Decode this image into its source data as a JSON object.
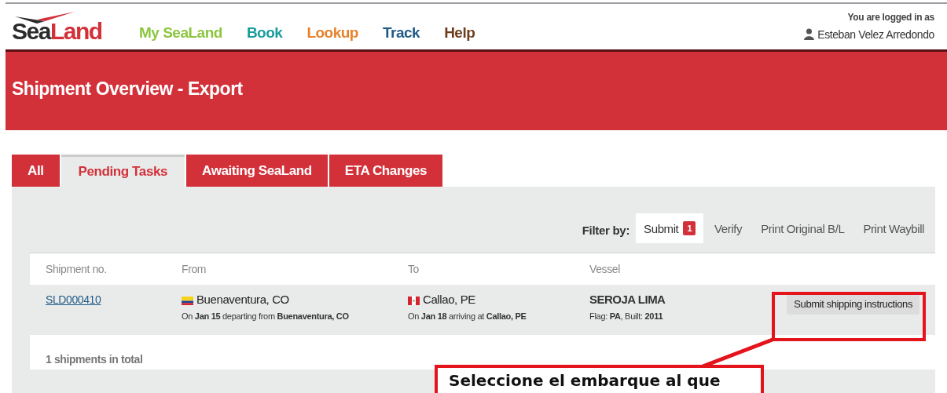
{
  "header": {
    "logo": {
      "first": "Sea",
      "second": "Land"
    },
    "nav": [
      {
        "label": "My SeaLand",
        "color": "#8cc63f"
      },
      {
        "label": "Book",
        "color": "#1a9c9c"
      },
      {
        "label": "Lookup",
        "color": "#e8822a"
      },
      {
        "label": "Track",
        "color": "#1f5a86"
      },
      {
        "label": "Help",
        "color": "#6b3e1e"
      }
    ],
    "user": {
      "caption": "You are logged in as",
      "name": "Esteban Velez Arredondo"
    }
  },
  "page_title": "Shipment Overview - Export",
  "tabs": [
    {
      "label": "All",
      "selected": false
    },
    {
      "label": "Pending Tasks",
      "selected": true
    },
    {
      "label": "Awaiting SeaLand",
      "selected": false
    },
    {
      "label": "ETA Changes",
      "selected": false
    }
  ],
  "filter": {
    "label": "Filter by:",
    "options": [
      {
        "label": "Submit",
        "badge": "1",
        "selected": true
      },
      {
        "label": "Verify",
        "selected": false
      },
      {
        "label": "Print Original B/L",
        "selected": false
      },
      {
        "label": "Print Waybill",
        "selected": false
      }
    ]
  },
  "table": {
    "columns": [
      "Shipment no.",
      "From",
      "To",
      "Vessel"
    ],
    "rows": [
      {
        "shipment_no": "SLD000410",
        "from": {
          "kind": "co",
          "place": "Buenaventura, CO",
          "detail": "On **Jan 15** departing from **Buenaventura, CO**"
        },
        "to": {
          "kind": "pe",
          "place": "Callao, PE",
          "detail": "On **Jan 18** arriving at **Callao, PE**"
        },
        "vessel": {
          "name": "SEROJA LIMA",
          "detail": "Flag: **PA**, Built: **2011**"
        },
        "action": "Submit shipping instructions"
      }
    ],
    "footer": "1 shipments in total"
  },
  "annotation": {
    "text": "Seleccione el embarque al que"
  }
}
